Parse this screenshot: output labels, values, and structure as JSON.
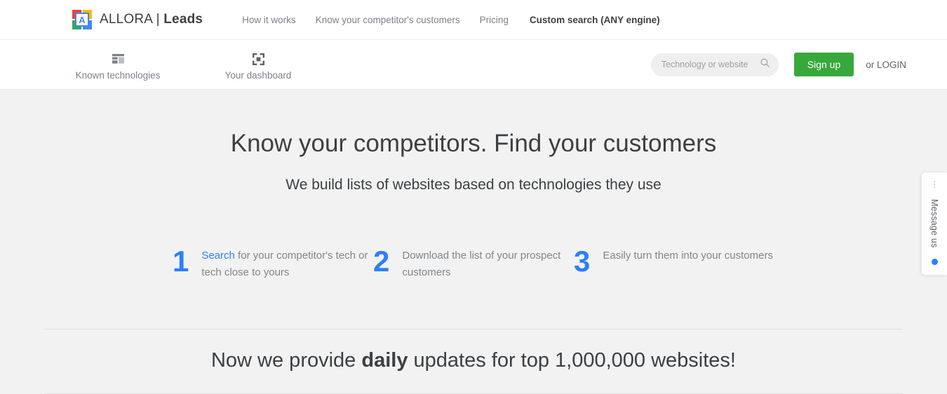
{
  "header": {
    "logo_letter": "A",
    "logo_colors": {
      "top_left": "#ea4335",
      "top_right": "#fbbc05",
      "bottom_left": "#34a853",
      "bottom_right": "#4285f4"
    },
    "brand_first": "ALLORA",
    "brand_separator": "|",
    "brand_second": "Leads",
    "nav": [
      {
        "label": "How it works",
        "strong": false
      },
      {
        "label": "Know your competitor's customers",
        "strong": false
      },
      {
        "label": "Pricing",
        "strong": false
      },
      {
        "label": "Custom search (ANY engine)",
        "strong": true
      }
    ]
  },
  "subheader": {
    "items": [
      {
        "label": "Known technologies",
        "icon": "table-grid-icon"
      },
      {
        "label": "Your dashboard",
        "icon": "dashboard-expand-icon"
      }
    ],
    "search": {
      "placeholder": "Technology or website",
      "value": "",
      "icon": "search-icon"
    },
    "signup_label": "Sign up",
    "signup_color": "#37a93c",
    "login_text": "or LOGIN"
  },
  "hero": {
    "title": "Know your competitors. Find your customers",
    "subtitle": "We build lists of websites based on technologies they use"
  },
  "steps": [
    {
      "number": "1",
      "link_text": "Search",
      "text_after": " for your competitor's tech or tech close to yours",
      "full_text": "Search for your competitor's tech or tech close to yours"
    },
    {
      "number": "2",
      "link_text": "",
      "text_after": "Download the list of your prospect customers",
      "full_text": "Download the list of your prospect customers"
    },
    {
      "number": "3",
      "link_text": "",
      "text_after": "Easily turn them into your customers",
      "full_text": "Easily turn them into your customers"
    }
  ],
  "promo": {
    "prefix": "Now we provide ",
    "emphasis": "daily",
    "suffix": " updates for top 1,000,000 websites!"
  },
  "message_widget": {
    "label": "Message us",
    "dots_icon": "vertical-dots-icon",
    "status_color": "#2d7ff9"
  },
  "colors": {
    "accent_blue": "#2d7ff9",
    "green": "#37a93c",
    "page_background": "#f2f2f2",
    "header_background": "#ffffff",
    "muted_text": "#80868b"
  }
}
